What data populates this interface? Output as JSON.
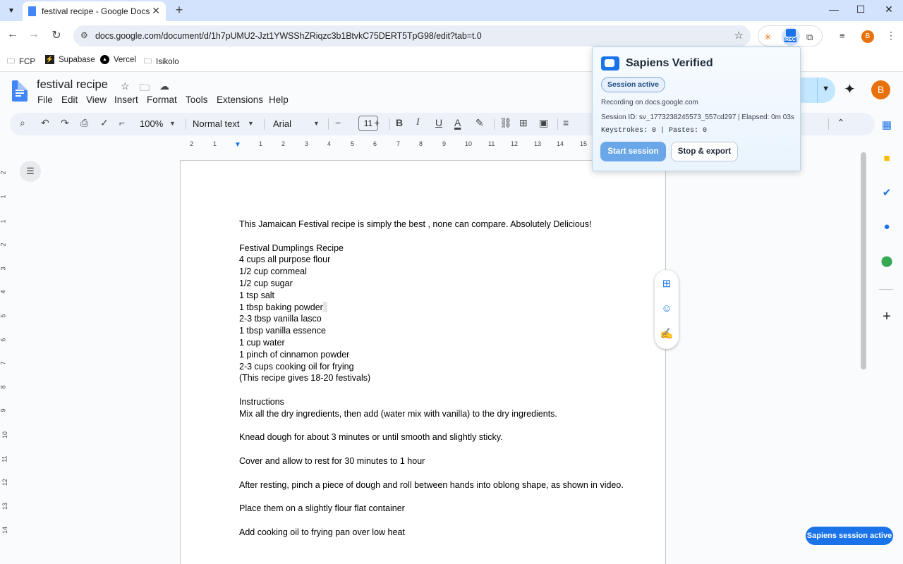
{
  "browser": {
    "tab_title": "festival recipe - Google Docs",
    "url": "docs.google.com/document/d/1h7pUMU2-Jzt1YWSShZRiqzc3b1BtvkC75DERT5TpG98/edit?tab=t.0",
    "profile_initial": "B",
    "rec_label": "REC",
    "bookmarks": [
      "FCP",
      "Supabase",
      "Vercel",
      "Isikolo"
    ]
  },
  "docs": {
    "title": "festival recipe",
    "menu": [
      "File",
      "Edit",
      "View",
      "Insert",
      "Format",
      "Tools",
      "Extensions",
      "Help"
    ],
    "share_label": "re",
    "avatar_initial": "B",
    "zoom": "100%",
    "style": "Normal text",
    "font": "Arial",
    "font_size": "11"
  },
  "ruler_ticks": [
    "2",
    "1",
    "1",
    "2",
    "3",
    "4",
    "5",
    "6",
    "7",
    "8",
    "9",
    "10",
    "11",
    "12",
    "13",
    "14",
    "15"
  ],
  "vruler_ticks": [
    "2",
    "1",
    "1",
    "2",
    "3",
    "4",
    "5",
    "6",
    "7",
    "8",
    "9",
    "10",
    "11",
    "12",
    "13",
    "14"
  ],
  "document": {
    "paragraphs": [
      "This Jamaican Festival recipe is simply the best , none can compare. Absolutely Delicious!",
      "",
      "Festival Dumplings Recipe",
      "4 cups all purpose flour",
      "1/2 cup cornmeal",
      "1/2 cup sugar",
      "1 tsp salt",
      "1 tbsp baking powder",
      "2-3 tbsp vanilla lasco",
      "1 tbsp vanilla essence",
      "1 cup water",
      "1 pinch of cinnamon powder",
      "2-3 cups cooking oil for frying",
      "(This recipe gives 18-20 festivals)",
      "",
      "Instructions",
      "Mix all the dry ingredients, then add (water mix with vanilla) to the dry ingredients.",
      "",
      "Knead dough for about 3 minutes or until smooth and slightly sticky.",
      "",
      "Cover and allow to rest for 30 minutes to 1 hour",
      "",
      "After resting, pinch a piece of dough and roll between hands into oblong shape, as shown in video.",
      "",
      "Place them on a slightly flour flat container",
      "",
      "Add cooking oil to frying pan over low heat"
    ]
  },
  "popup": {
    "title": "Sapiens Verified",
    "status_badge": "Session active",
    "recording_on": "Recording on docs.google.com",
    "session_info": "Session ID: sv_1773238245573_557cd297 | Elapsed: 0m 03s",
    "counters": "Keystrokes: 0 | Pastes: 0",
    "start_label": "Start session",
    "stop_label": "Stop & export"
  },
  "floating_badge": "Sapiens session active",
  "colors": {
    "accent": "#1a73e8",
    "tab_strip": "#d3e3fd",
    "share_button": "#c2e7ff",
    "avatar": "#e8710a"
  }
}
